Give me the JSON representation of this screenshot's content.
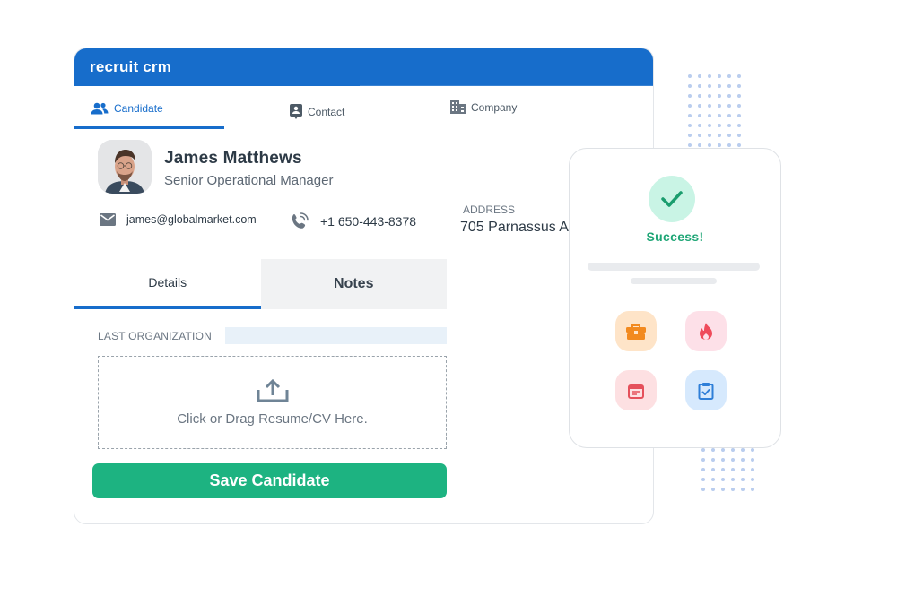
{
  "app": {
    "logo": "recruit crm",
    "brand_color": "#176dcb",
    "success_color": "#1db381"
  },
  "top_tabs": [
    {
      "label": "Candidate",
      "icon": "users-icon",
      "active": true
    },
    {
      "label": "Contact",
      "icon": "contact-card-icon",
      "active": false
    },
    {
      "label": "Company",
      "icon": "building-icon",
      "active": false
    }
  ],
  "candidate": {
    "name": "James Matthews",
    "title": "Senior Operational Manager",
    "email": "james@globalmarket.com",
    "phone": "+1 650-443-8378",
    "address_label": "ADDRESS",
    "address_value": "705 Parnassus A"
  },
  "sub_tabs": [
    {
      "label": "Details",
      "active": true
    },
    {
      "label": "Notes",
      "active": false
    }
  ],
  "form": {
    "last_org_label": "LAST ORGANIZATION",
    "last_org_value": "",
    "dropzone_text": "Click or Drag Resume/CV Here.",
    "save_label": "Save Candidate"
  },
  "success_card": {
    "message": "Success!",
    "tiles": [
      {
        "icon": "briefcase-icon",
        "color": "#f28a1f"
      },
      {
        "icon": "fire-icon",
        "color": "#ef4b5b"
      },
      {
        "icon": "calendar-icon",
        "color": "#e5505b"
      },
      {
        "icon": "clipboard-check-icon",
        "color": "#2f7fd8"
      }
    ]
  }
}
